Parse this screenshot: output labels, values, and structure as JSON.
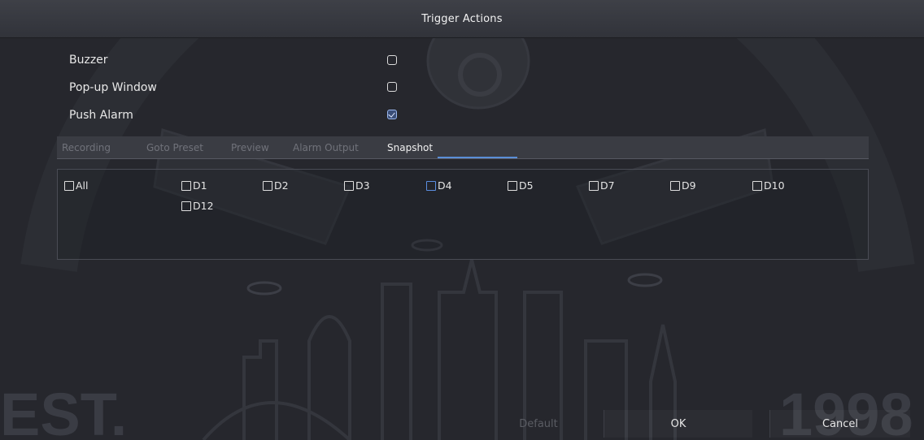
{
  "dialog": {
    "title": "Trigger Actions"
  },
  "options": [
    {
      "label": "Buzzer",
      "checked": false
    },
    {
      "label": "Pop-up Window",
      "checked": false
    },
    {
      "label": "Push Alarm",
      "checked": true
    }
  ],
  "tabs": [
    {
      "label": "Recording",
      "active": false
    },
    {
      "label": "Goto Preset",
      "active": false
    },
    {
      "label": "Preview",
      "active": false
    },
    {
      "label": "Alarm Output",
      "active": false
    },
    {
      "label": "Snapshot",
      "active": true
    }
  ],
  "channels": [
    {
      "label": "All",
      "checked": false
    },
    {
      "label": "D1",
      "checked": false
    },
    {
      "label": "D2",
      "checked": false
    },
    {
      "label": "D3",
      "checked": false
    },
    {
      "label": "D4",
      "checked": false,
      "focused": true
    },
    {
      "label": "D5",
      "checked": false
    },
    {
      "label": "D7",
      "checked": false
    },
    {
      "label": "D9",
      "checked": false
    },
    {
      "label": "D10",
      "checked": false
    },
    {
      "label": "D12",
      "checked": false
    }
  ],
  "footer": {
    "default_label": "Default",
    "ok_label": "OK",
    "cancel_label": "Cancel"
  },
  "watermark": {
    "left_text": "EST.",
    "right_text": "1998"
  },
  "colors": {
    "accent": "#5a8fd8",
    "background": "#26272d",
    "title_bar": "#3a3c43"
  }
}
